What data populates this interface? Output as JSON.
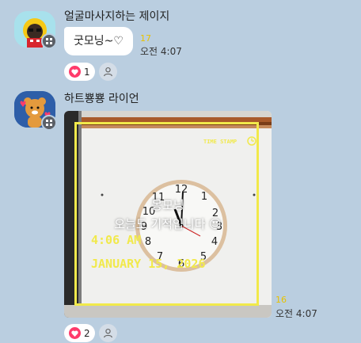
{
  "colors": {
    "background": "#bacee0",
    "bubble": "#ffffff",
    "unread": "#e8c200",
    "heart": "#ff3b6b",
    "stamp_frame": "#f1e94b"
  },
  "messages": [
    {
      "sender": "얼굴마사지하는 제이지",
      "avatar_icon": "jay-g-character-icon",
      "text": "굿모닝~♡",
      "unread": "17",
      "time": "오전 4:07",
      "reaction_count": "1"
    },
    {
      "sender": "하트뿅뿅 라이언",
      "avatar_icon": "ryan-character-icon",
      "photo": {
        "caption_line1": "몽모닝",
        "caption_line2": "오늘도 기적입니다 😍",
        "stamp_label": "TIME STAMP",
        "stamp_time": "4:06 AM",
        "stamp_date": "JANUARY 15, 2026"
      },
      "unread": "16",
      "time": "오전 4:07",
      "reaction_count": "2"
    }
  ]
}
